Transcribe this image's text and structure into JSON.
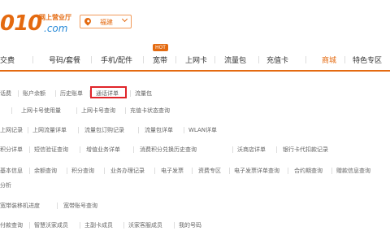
{
  "header": {
    "logo_number": "010",
    "logo_top": "网上营业厅",
    "logo_domain": ".com",
    "city": "福建"
  },
  "nav": {
    "items": [
      "交费",
      "号码/套餐",
      "手机/配件",
      "宽带",
      "上网卡",
      "流量包",
      "充值卡",
      "商城",
      "特色专区"
    ],
    "hot_badge": "HOT"
  },
  "rows": [
    [
      "话费",
      "账户余额",
      "历史账单",
      "通话详单",
      "流量包"
    ],
    [
      "上网卡号使用量",
      "上网卡号查询",
      "充值卡状态查询"
    ],
    [
      "上网记录",
      "上网流量详单",
      "流量包订购记录",
      "流量包详单",
      "WLAN详单"
    ],
    [
      "积分详单",
      "短信验证查询",
      "增值业务详单",
      "消费积分兑换历史查询",
      "沃商店详单",
      "银行卡代扣款记录"
    ],
    [
      "基本信息",
      "余额查询",
      "积分查询",
      "业务办理记录",
      "电子发票",
      "资费专区",
      "电子发票详单查询",
      "合约期查询",
      "赠款信息查询"
    ],
    [
      "分析"
    ],
    [
      "宽带装移机进度",
      "宽带账号查询"
    ],
    [
      "付款查询",
      "智慧沃家成员",
      "主副卡成员",
      "沃家客服成员",
      "我的号码"
    ]
  ]
}
